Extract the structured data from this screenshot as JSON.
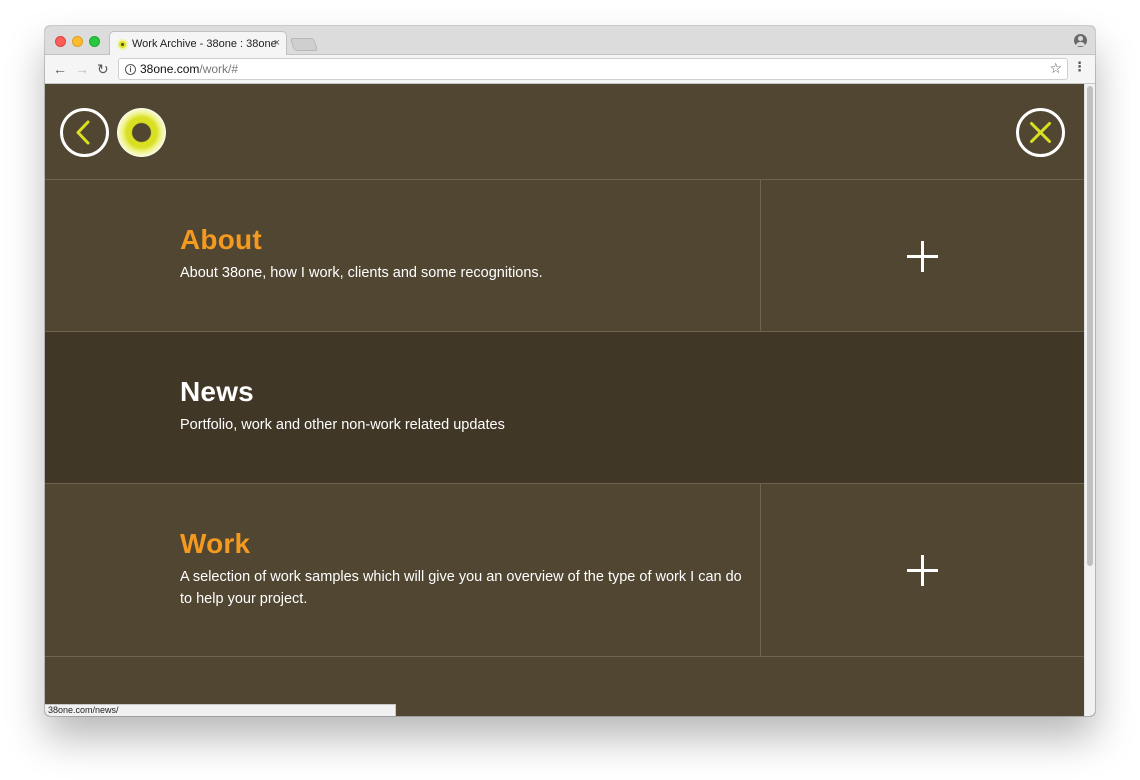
{
  "browser": {
    "tab_title": "Work Archive - 38one : 38one",
    "tab_close": "×",
    "url_host": "38one.com",
    "url_path": "/work/#",
    "status_url": "38one.com/news/",
    "icons": [
      "back-arrow-icon",
      "forward-arrow-icon",
      "reload-icon",
      "info-icon",
      "star-icon",
      "menu-icon",
      "profile-icon"
    ]
  },
  "header": {
    "accent_color": "#d9e021",
    "icons": [
      "back-chevron-icon",
      "logo",
      "close-x-icon"
    ]
  },
  "sections": [
    {
      "title": "About",
      "description": "About 38one, how I work, clients and some recognitions.",
      "expandable": true
    },
    {
      "title": "News",
      "description": "Portfolio, work and other non-work related updates",
      "expandable": false
    },
    {
      "title": "Work",
      "description": "A selection of work samples which will give you an overview of the type of work I can do to help your project.",
      "expandable": true
    }
  ],
  "colors": {
    "background": "#514632",
    "active_row": "#403726",
    "title_orange": "#f49a1f",
    "text": "#ffffff"
  }
}
